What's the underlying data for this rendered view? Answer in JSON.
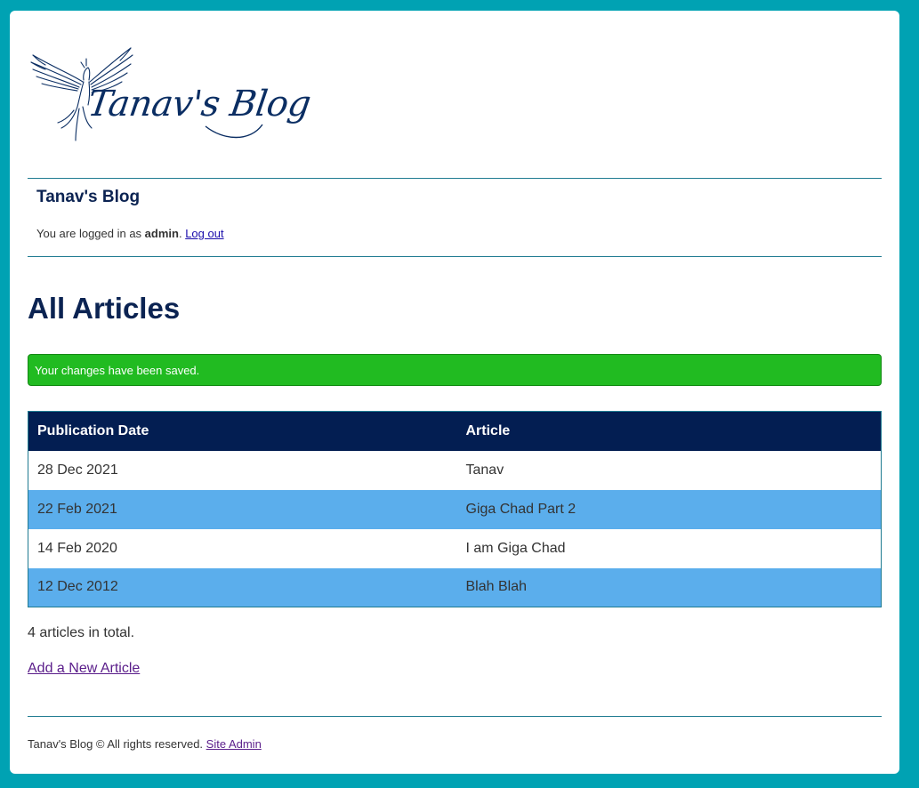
{
  "logo": {
    "text": "Tanav's Blog",
    "icon": "phoenix-bird-icon"
  },
  "header": {
    "site_title": "Tanav's Blog",
    "login_prefix": "You are logged in as ",
    "username": "admin",
    "login_suffix": ". ",
    "logout_label": "Log out"
  },
  "main": {
    "heading": "All Articles",
    "alert": "Your changes have been saved.",
    "table": {
      "columns": [
        "Publication Date",
        "Article"
      ],
      "rows": [
        {
          "date": "28 Dec 2021",
          "title": "Tanav"
        },
        {
          "date": "22 Feb 2021",
          "title": "Giga Chad Part 2"
        },
        {
          "date": "14 Feb 2020",
          "title": "I am Giga Chad"
        },
        {
          "date": "12 Dec 2012",
          "title": "Blah Blah"
        }
      ]
    },
    "total_text": "4 articles in total.",
    "add_label": "Add a New Article"
  },
  "footer": {
    "text": "Tanav's Blog © All rights reserved. ",
    "admin_link": "Site Admin"
  },
  "colors": {
    "page_bg": "#00a2b3",
    "brand_navy": "#031e52",
    "success_green": "#21bb21",
    "row_highlight": "#5baeec"
  }
}
